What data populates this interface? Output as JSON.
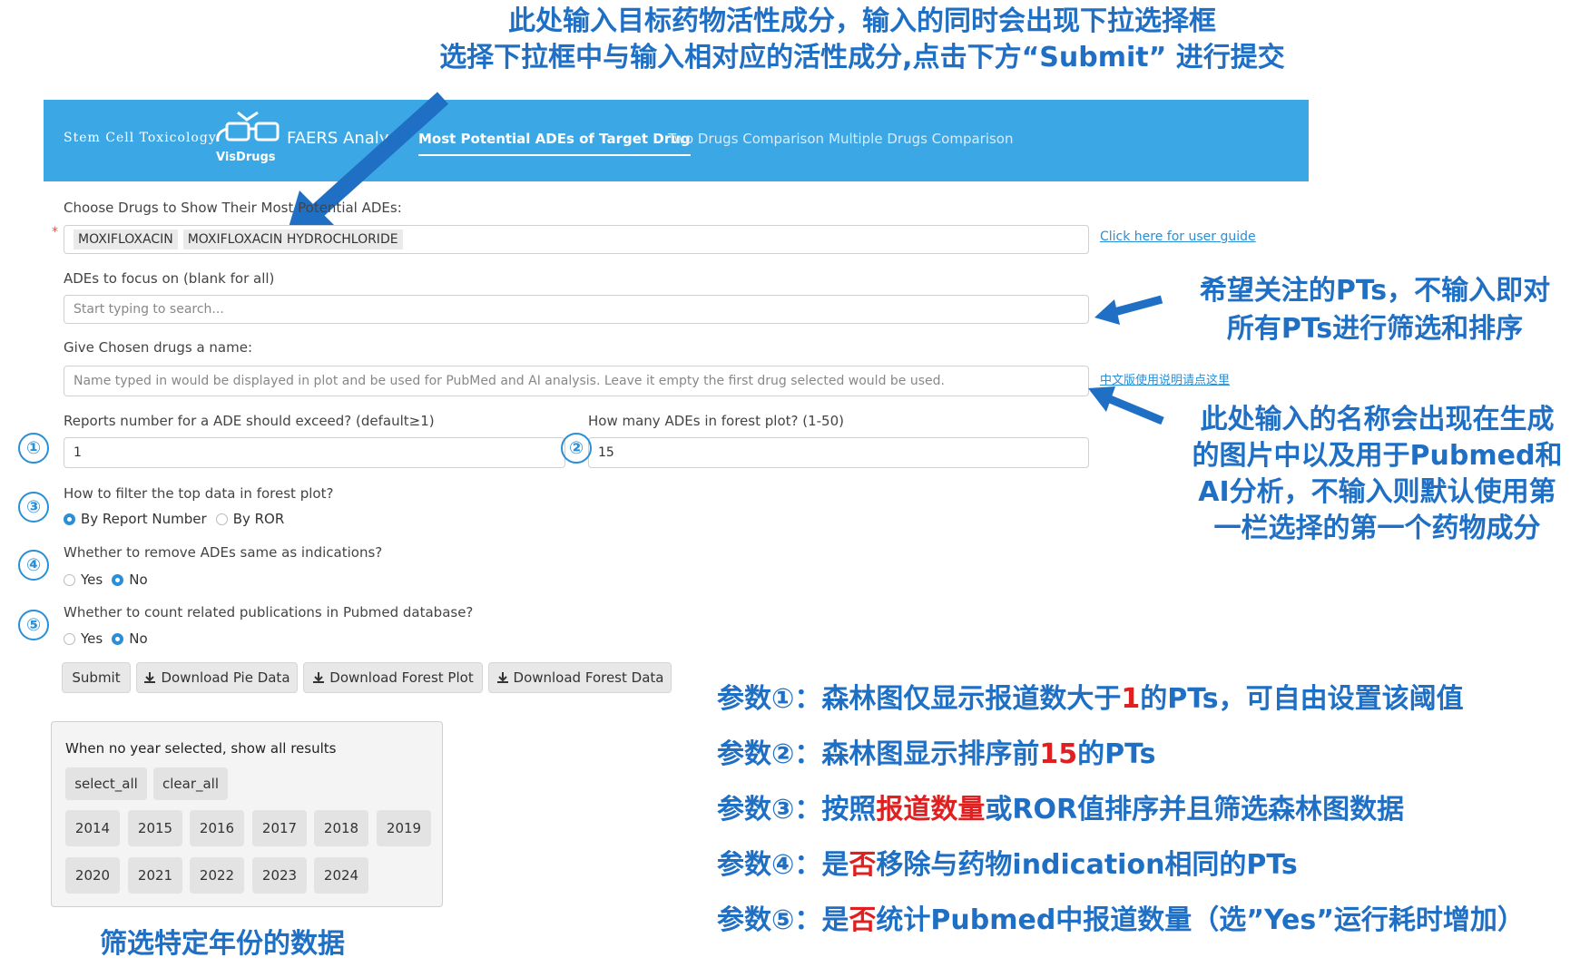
{
  "top_annotation": {
    "line1": "此处输入目标药物活性成分，输入的同时会出现下拉选择框",
    "line2": "选择下拉框中与输入相对应的活性成分,点击下方“Submit” 进行提交"
  },
  "navbar": {
    "brand": "Stem Cell Toxicology",
    "logo_text": "VisDrugs",
    "app_title": "FAERS Analy",
    "tabs": [
      {
        "label": "Most Potential ADEs of Target Drug",
        "active": true
      },
      {
        "label": "Two Drugs Comparison",
        "active": false
      },
      {
        "label": "Multiple Drugs Comparison",
        "active": false
      }
    ],
    "bg_color": "#3ba7e4"
  },
  "form": {
    "drugs_label": "Choose Drugs to Show Their Most Potential ADEs:",
    "required_mark": "*",
    "drug_chips": [
      "MOXIFLOXACIN",
      "MOXIFLOXACIN HYDROCHLORIDE"
    ],
    "user_guide_link": "Click here for user guide",
    "ades_label": "ADEs to focus on (blank for all)",
    "ades_placeholder": "Start typing to search...",
    "name_label": "Give Chosen drugs a name:",
    "name_placeholder": "Name typed in would be displayed in plot and be used for PubMed and AI analysis. Leave it empty the first drug selected would be used.",
    "chinese_guide_link": "中文版使用说明请点这里",
    "reports_label": "Reports number for a ADE should exceed? (default≥1)",
    "reports_value": "1",
    "forest_count_label": "How many ADEs in forest plot? (1-50)",
    "forest_count_value": "15",
    "filter_label": "How to filter the top data in forest plot?",
    "filter_options": [
      "By Report Number",
      "By ROR"
    ],
    "filter_selected": "By Report Number",
    "remove_label": "Whether to remove ADEs same as indications?",
    "remove_options": [
      "Yes",
      "No"
    ],
    "remove_selected": "No",
    "pubmed_label": "Whether to count related publications in Pubmed database?",
    "pubmed_options": [
      "Yes",
      "No"
    ],
    "pubmed_selected": "No"
  },
  "buttons": {
    "submit": "Submit",
    "download_pie": "Download Pie Data",
    "download_forest_plot": "Download Forest Plot",
    "download_forest_data": "Download Forest Data"
  },
  "year_panel": {
    "note": "When no year selected, show all results",
    "select_all": "select_all",
    "clear_all": "clear_all",
    "years": [
      "2014",
      "2015",
      "2016",
      "2017",
      "2018",
      "2019",
      "2020",
      "2021",
      "2022",
      "2023",
      "2024"
    ]
  },
  "year_caption": "筛选特定年份的数据",
  "circle_numbers": [
    "①",
    "②",
    "③",
    "④",
    "⑤"
  ],
  "right_notes": {
    "pts_note_line1": "希望关注的PTs，不输入即对",
    "pts_note_line2": "所有PTs进行筛选和排序",
    "name_note_lines": [
      "此处输入的名称会出现在生成",
      "的图片中以及用于Pubmed和",
      "AI分析，不输入则默认使用第",
      "一栏选择的第一个药物成分"
    ]
  },
  "params": [
    {
      "prefix": "参数①：森林图仅显示报道数大于",
      "highlight": "1",
      "suffix": "的PTs，可自由设置该阈值"
    },
    {
      "prefix": "参数②：森林图显示排序前",
      "highlight": "15",
      "suffix": "的PTs"
    },
    {
      "prefix": "参数③：按照",
      "highlight": "报道数量",
      "suffix": "或ROR值排序并且筛选森林图数据"
    },
    {
      "prefix": "参数④：是",
      "highlight": "否",
      "suffix": "移除与药物indication相同的PTs"
    },
    {
      "prefix": "参数⑤：是",
      "highlight": "否",
      "suffix": "统计Pubmed中报道数量（选”Yes”运行耗时增加）"
    }
  ],
  "colors": {
    "annotation_blue": "#1f6fc4",
    "highlight_red": "#e02020",
    "link_blue": "#2a8fd6"
  }
}
